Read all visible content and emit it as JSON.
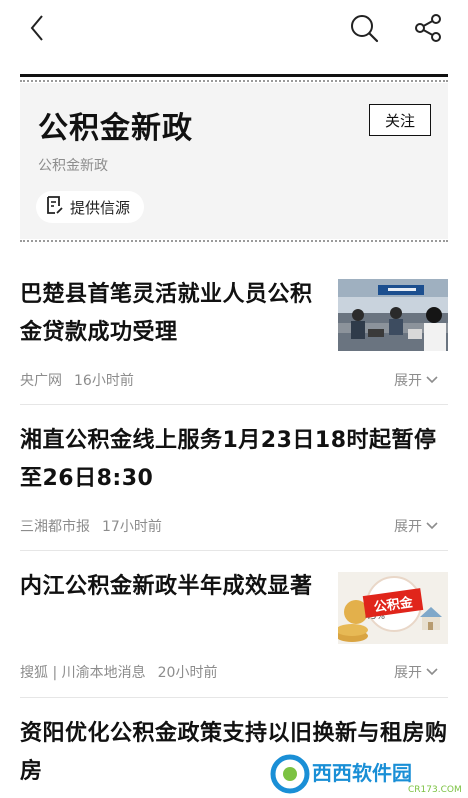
{
  "topic": {
    "title": "公积金新政",
    "subtitle": "公积金新政",
    "follow_label": "关注",
    "source_label": "提供信源"
  },
  "news": [
    {
      "title": "巴楚县首笔灵活就业人员公积金贷款成功受理",
      "source": "央广网",
      "time": "16小时前",
      "expand_label": "展开",
      "thumb": "office-service-hall-photo"
    },
    {
      "title": "湘直公积金线上服务1月23日18时起暂停至26日8:30",
      "source": "三湘都市报",
      "time": "17小时前",
      "expand_label": "展开"
    },
    {
      "title": "内江公积金新政半年成效显著",
      "source": "搜狐 | 川渝本地消息",
      "time": "20小时前",
      "expand_label": "展开",
      "thumb": "gjj-coins-house-graphic",
      "thumb_text": "公积金",
      "thumb_percent": "45%"
    },
    {
      "title": "资阳优化公积金政策支持以旧换新与租房购房"
    }
  ],
  "watermark": {
    "text": "西西软件园",
    "url": "CR173.COM"
  },
  "colors": {
    "text": "#111111",
    "muted": "#8d8d8d",
    "card_bg": "#f4f4f4",
    "divider": "#e6e6e6"
  }
}
